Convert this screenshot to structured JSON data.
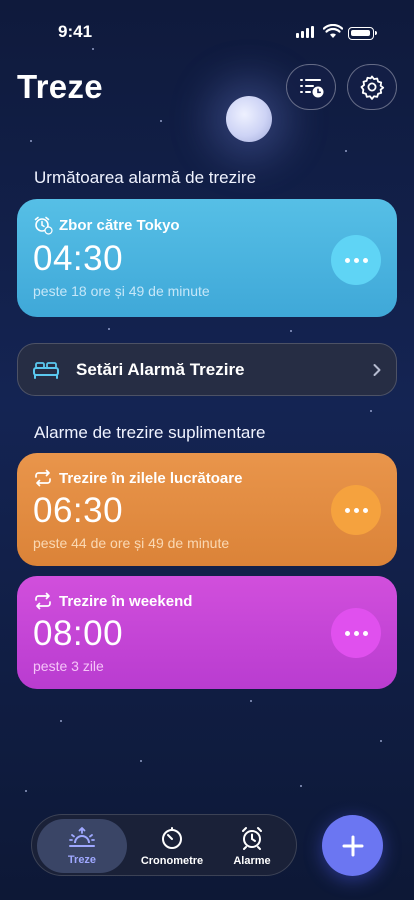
{
  "status_bar": {
    "time": "9:41"
  },
  "header": {
    "title": "Treze",
    "list_button_icon": "list-clock-icon",
    "settings_button_icon": "gear-icon"
  },
  "next_alarm": {
    "section_title": "Următoarea alarmă de trezire",
    "name": "Zbor către Tokyo",
    "time": "04:30",
    "countdown": "peste 18 ore și 49 de minute",
    "color": "#4db5e0"
  },
  "settings_row": {
    "label": "Setări Alarmă Trezire",
    "icon": "bed-icon"
  },
  "additional": {
    "section_title": "Alarme de trezire suplimentare",
    "alarms": [
      {
        "name": "Trezire în zilele lucrătoare",
        "time": "06:30",
        "countdown": "peste 44 de ore și 49 de minute",
        "color": "#e28c42"
      },
      {
        "name": "Trezire în weekend",
        "time": "08:00",
        "countdown": "peste 3 zile",
        "color": "#c846d6"
      }
    ]
  },
  "tabs": [
    {
      "label": "Treze",
      "icon": "sunrise-icon",
      "active": true
    },
    {
      "label": "Cronometre",
      "icon": "timer-icon",
      "active": false
    },
    {
      "label": "Alarme",
      "icon": "alarm-clock-icon",
      "active": false
    }
  ],
  "add_button_icon": "plus-icon"
}
